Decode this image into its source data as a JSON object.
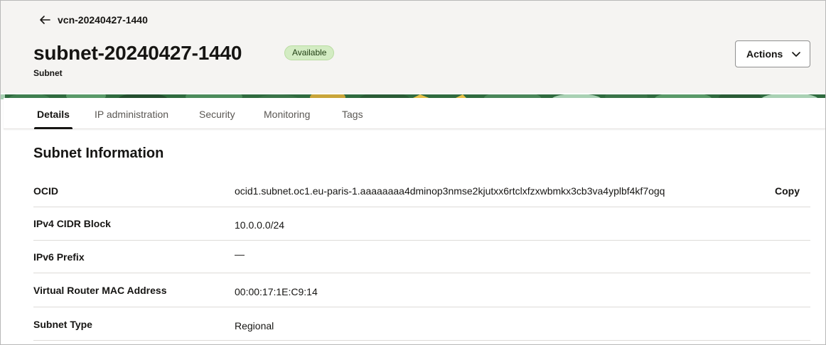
{
  "breadcrumb": {
    "back_label": "vcn-20240427-1440"
  },
  "header": {
    "title": "subnet-20240427-1440",
    "status": "Available",
    "subtitle": "Subnet",
    "actions_label": "Actions"
  },
  "tabs": [
    {
      "label": "Details",
      "active": true
    },
    {
      "label": "IP administration",
      "active": false
    },
    {
      "label": "Security",
      "active": false
    },
    {
      "label": "Monitoring",
      "active": false
    },
    {
      "label": "Tags",
      "active": false
    }
  ],
  "section": {
    "title": "Subnet Information"
  },
  "details": {
    "rows": [
      {
        "label": "OCID",
        "value": "ocid1.subnet.oc1.eu-paris-1.aaaaaaaa4dminop3nmse2kjutxx6rtclxfzxwbmkx3cb3va4yplbf4kf7ogq",
        "action": "Copy"
      },
      {
        "label": "IPv4 CIDR Block",
        "value": "10.0.0.0/24"
      },
      {
        "label": "IPv6 Prefix",
        "value": "—"
      },
      {
        "label": "Virtual Router MAC Address",
        "value": "00:00:17:1E:C9:14"
      },
      {
        "label": "Subnet Type",
        "value": "Regional"
      }
    ]
  },
  "icons": {
    "back": "arrow-left-icon",
    "actions": "chevron-down-icon"
  },
  "colors": {
    "header_bg": "#f5f4f2",
    "badge_bg": "#d3ecc3",
    "text": "#161513",
    "banner_green": "#2f6b3f"
  }
}
